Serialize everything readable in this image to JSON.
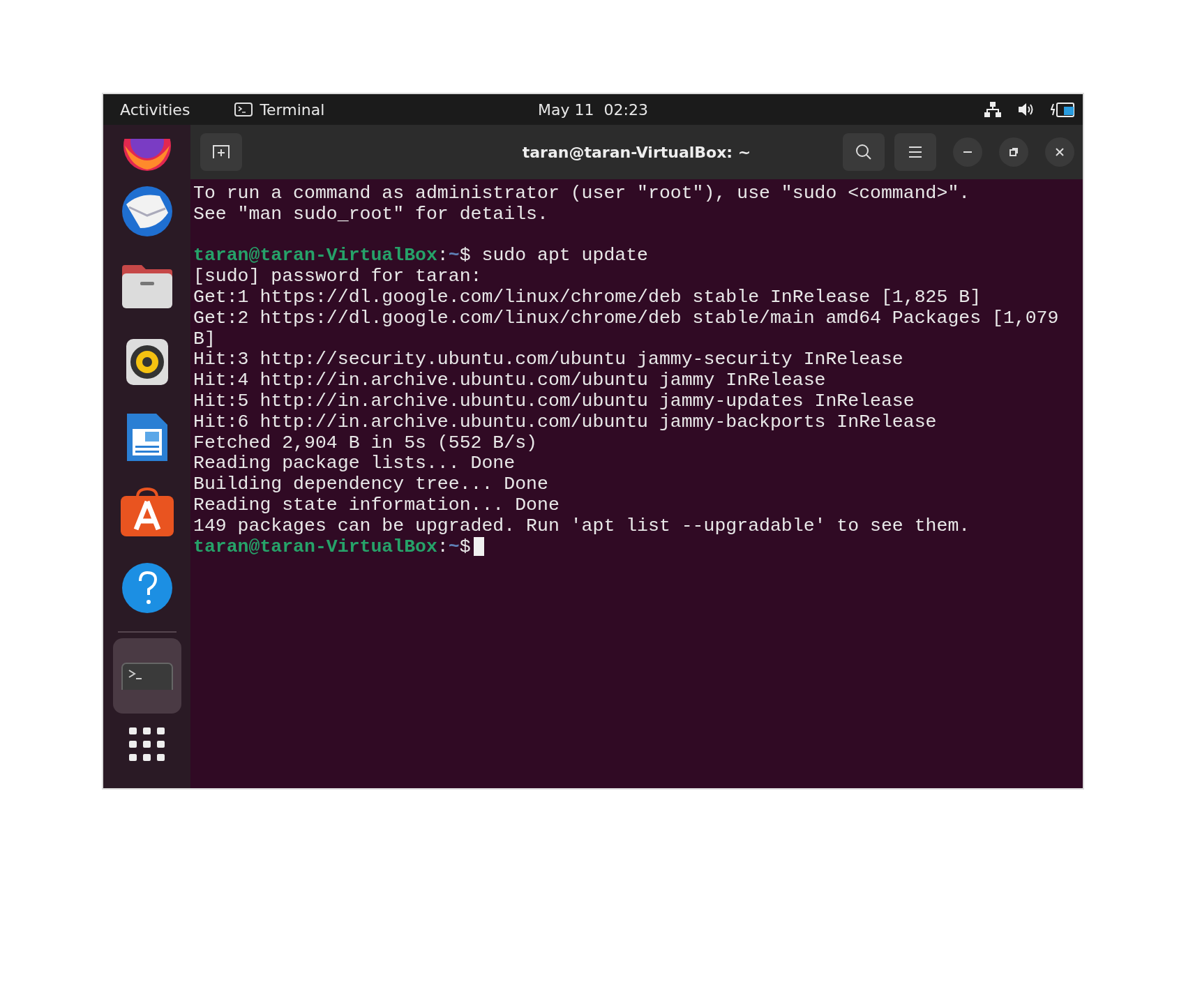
{
  "top_bar": {
    "activities": "Activities",
    "app_name": "Terminal",
    "clock": "May 11  02:23"
  },
  "dock_items": [
    {
      "selected": false
    },
    {
      "selected": false
    },
    {
      "selected": false
    },
    {
      "selected": false
    },
    {
      "selected": false
    },
    {
      "selected": false
    },
    {
      "selected": false
    },
    {
      "selected": true
    }
  ],
  "window": {
    "title": "taran@taran-VirtualBox: ~"
  },
  "terminal": {
    "lines": [
      {
        "kind": "output",
        "text": "To run a command as administrator (user \"root\"), use \"sudo <command>\"."
      },
      {
        "kind": "output",
        "text": "See \"man sudo_root\" for details."
      },
      {
        "kind": "blank"
      },
      {
        "kind": "prompt",
        "user": "taran@taran-VirtualBox",
        "separator": ":",
        "path": "~",
        "symbol": "$",
        "command": "sudo apt update",
        "cursor": false
      },
      {
        "kind": "output",
        "text": "[sudo] password for taran:"
      },
      {
        "kind": "output",
        "text": "Get:1 https://dl.google.com/linux/chrome/deb stable InRelease [1,825 B]"
      },
      {
        "kind": "output",
        "text": "Get:2 https://dl.google.com/linux/chrome/deb stable/main amd64 Packages [1,079"
      },
      {
        "kind": "output",
        "text": "B]"
      },
      {
        "kind": "output",
        "text": "Hit:3 http://security.ubuntu.com/ubuntu jammy-security InRelease"
      },
      {
        "kind": "output",
        "text": "Hit:4 http://in.archive.ubuntu.com/ubuntu jammy InRelease"
      },
      {
        "kind": "output",
        "text": "Hit:5 http://in.archive.ubuntu.com/ubuntu jammy-updates InRelease"
      },
      {
        "kind": "output",
        "text": "Hit:6 http://in.archive.ubuntu.com/ubuntu jammy-backports InRelease"
      },
      {
        "kind": "output",
        "text": "Fetched 2,904 B in 5s (552 B/s)"
      },
      {
        "kind": "output",
        "text": "Reading package lists... Done"
      },
      {
        "kind": "output",
        "text": "Building dependency tree... Done"
      },
      {
        "kind": "output",
        "text": "Reading state information... Done"
      },
      {
        "kind": "output",
        "text": "149 packages can be upgraded. Run 'apt list --upgradable' to see them."
      },
      {
        "kind": "prompt",
        "user": "taran@taran-VirtualBox",
        "separator": ":",
        "path": "~",
        "symbol": "$",
        "cursor": true
      }
    ]
  }
}
